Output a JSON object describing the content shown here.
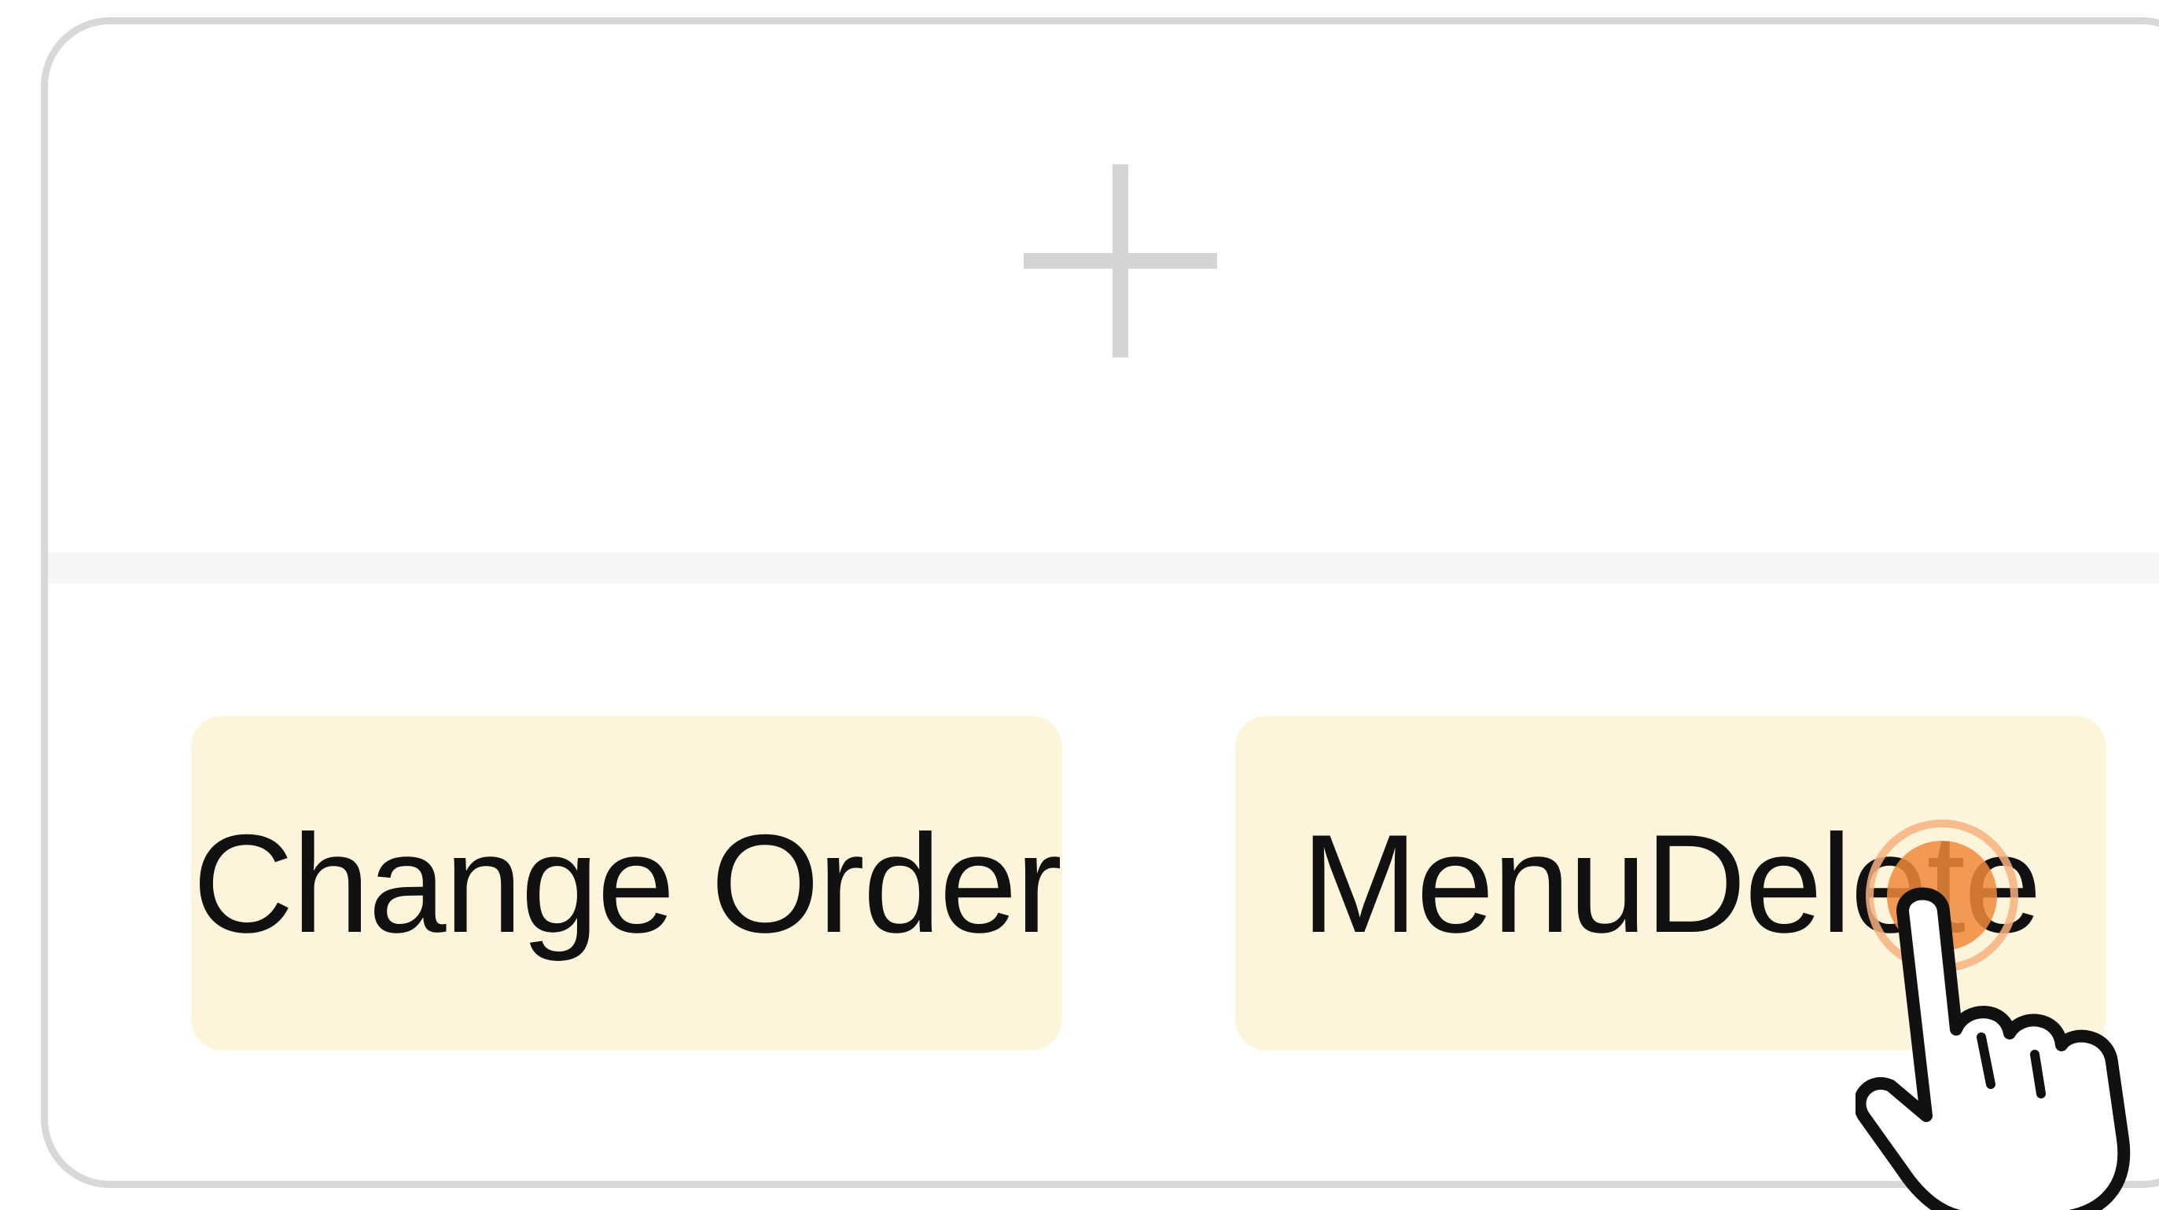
{
  "card": {
    "add_icon": "plus-icon",
    "buttons": [
      {
        "label": "Change Order"
      },
      {
        "label": "MenuDelete"
      }
    ]
  },
  "pointer": {
    "icon": "pointing-hand-icon",
    "tap_indicator_color": "#f08a3c"
  },
  "colors": {
    "button_background": "#fdf4dc",
    "card_border": "#d8d8d8",
    "plus_color": "#d4d4d4"
  }
}
